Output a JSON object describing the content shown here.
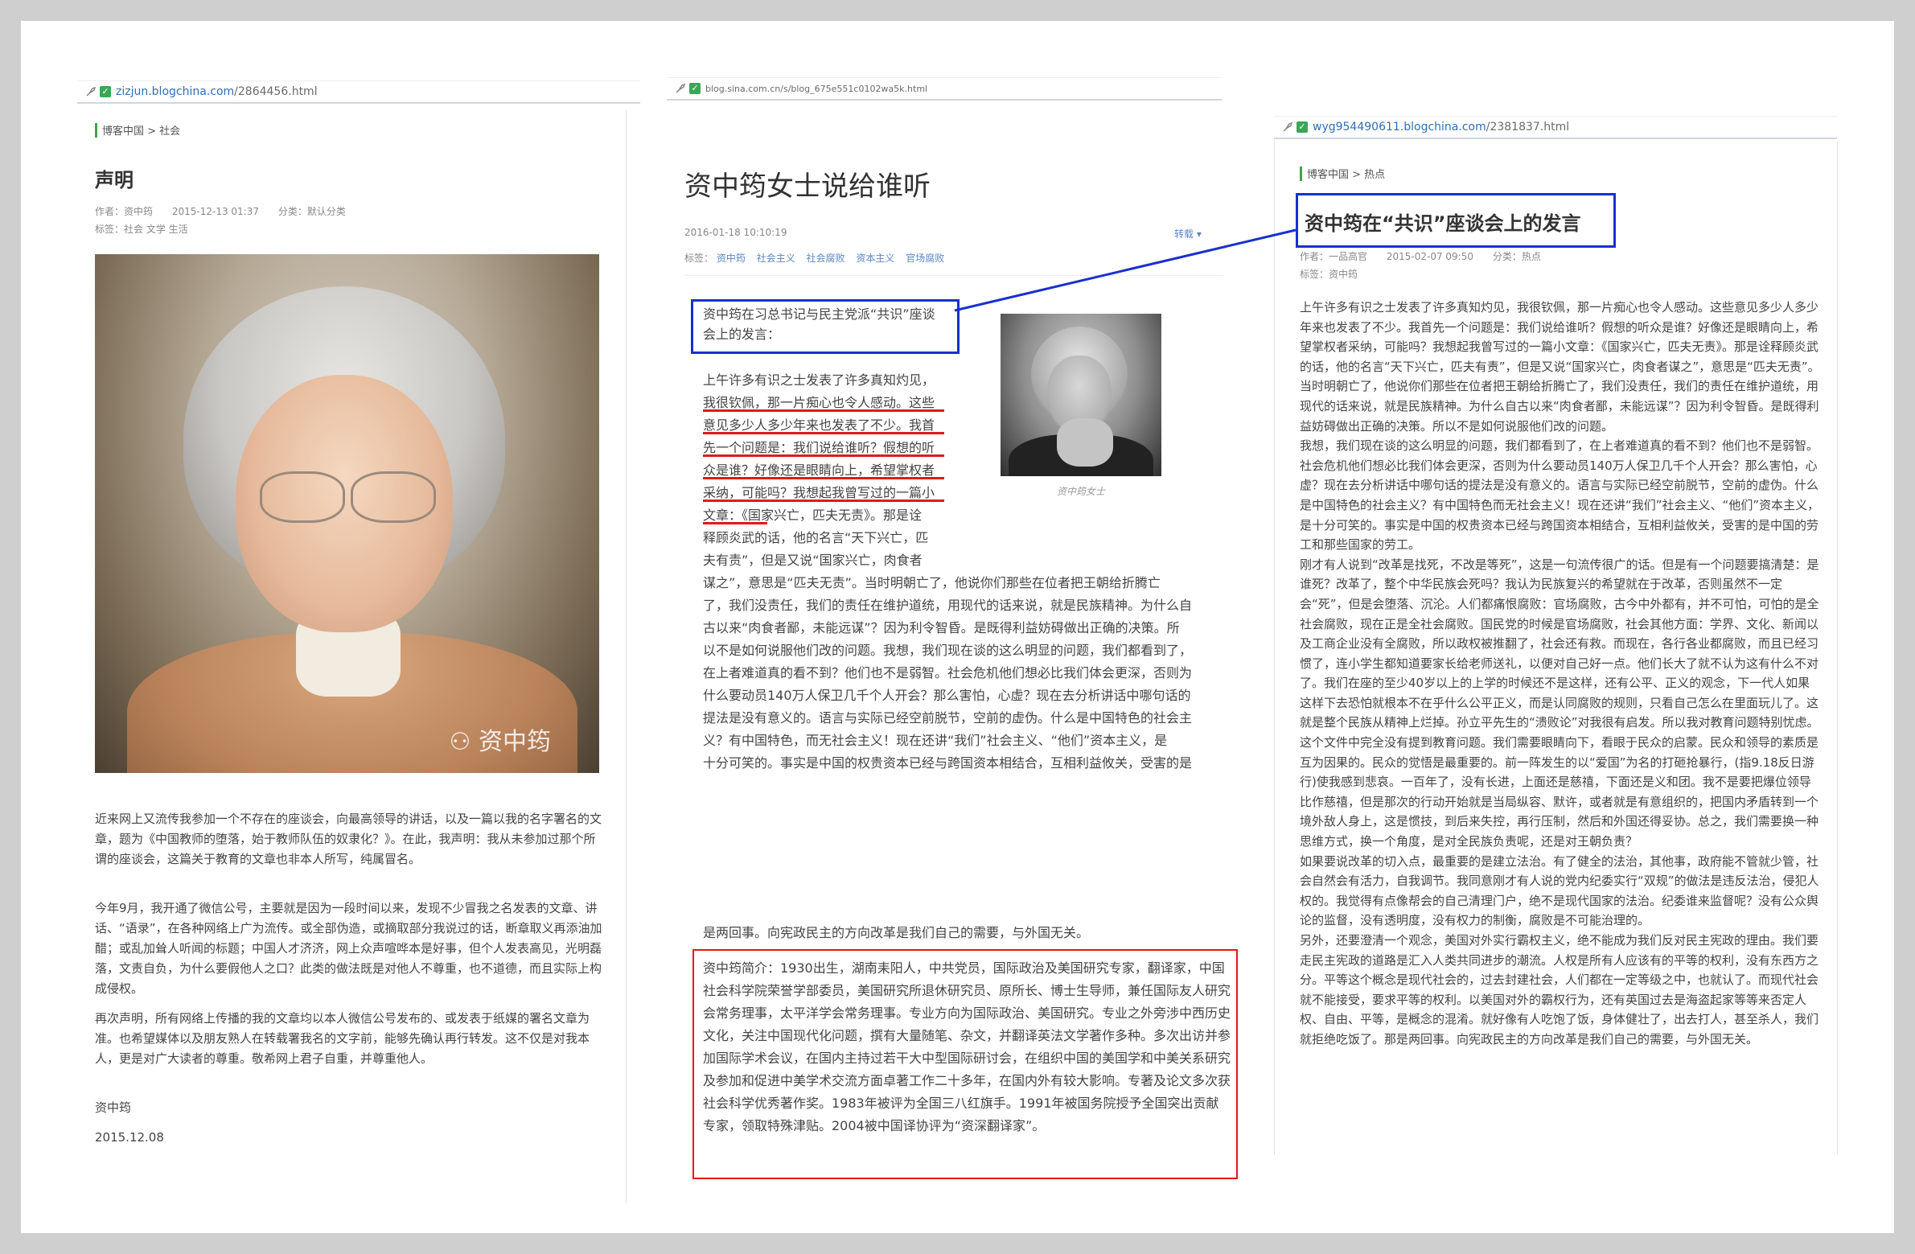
{
  "panel1": {
    "url_host": "zizjun.blogchina.com",
    "url_path": "/2864456.html",
    "breadcrumb": "博客中国 > 社会",
    "title": "声明",
    "meta_author": "作者：资中筠",
    "meta_date": "2015-12-13 01:37",
    "meta_category": "分类：默认分类",
    "tags": "标签：社会 文学 生活",
    "photo_watermark": "资中筠",
    "paragraphs": [
      "近来网上又流传我参加一个不存在的座谈会，向最高领导的讲话，以及一篇以我的名字署名的文章，题为《中国教师的堕落，始于教师队伍的奴隶化？》。在此，我声明：我从未参加过那个所谓的座谈会，这篇关于教育的文章也非本人所写，纯属冒名。",
      "今年9月，我开通了微信公号，主要就是因为一段时间以来，发现不少冒我之名发表的文章、讲话、“语录”，在各种网络上广为流传。或全部伪造，或摘取部分我说过的话，断章取义再添油加醋；或乱加耸人听闻的标题；中国人才济济，网上众声喧哗本是好事，但个人发表高见，光明磊落，文责自负，为什么要假他人之口？此类的做法既是对他人不尊重，也不道德，而且实际上构成侵权。",
      "再次声明，所有网络上传播的我的文章均以本人微信公号发布的、或发表于纸媒的署名文章为准。也希望媒体以及朋友熟人在转载署我名的文字前，能够先确认再行转发。这不仅是对我本人，更是对广大读者的尊重。敬希网上君子自重，并尊重他人。",
      "资中筠",
      "2015.12.08"
    ]
  },
  "panel2": {
    "url": "blog.sina.com.cn/s/blog_675e551c0102wa5k.html",
    "title": "资中筠女士说给谁听",
    "date": "2016-01-18 10:10:19",
    "reprint": "转载 ▾",
    "tags_label": "标签：",
    "tags": [
      "资中筠",
      "社会主义",
      "社会腐败",
      "资本主义",
      "官场腐败"
    ],
    "intro": "资中筠在习总书记与民主党派“共识”座谈会上的发言：",
    "photo_caption": "资中筠女士",
    "narrow_lines": [
      "上午许多有识之士发表了许多真知灼见，",
      "我很钦佩，那一片痴心也令人感动。这些",
      "意见多少人多少年来也发表了不少。我首",
      "先一个问题是：我们说给谁听？假想的听",
      "众是谁？好像还是眼睛向上，希望掌权者",
      "采纳，可能吗？我想起我曾写过的一篇小",
      "文章：《国家兴亡，匹夫无责》。那是诠",
      "释顾炎武的话，他的名言“天下兴亡，匹",
      "夫有责”，但是又说“国家兴亡，肉食者"
    ],
    "wide_lines": [
      "谋之”，意思是“匹夫无责”。当时明朝亡了，他说你们那些在位者把王朝给折腾亡",
      "了，我们没责任，我们的责任在维护道统，用现代的话来说，就是民族精神。为什么自",
      "古以来“肉食者鄙，未能远谋”？因为利令智昏。是既得利益妨碍做出正确的决策。所",
      "以不是如何说服他们改的问题。我想，我们现在谈的这么明显的问题，我们都看到了，",
      "在上者难道真的看不到？他们也不是弱智。社会危机他们想必比我们体会更深，否则为",
      "什么要动员140万人保卫几千个人开会？那么害怕，心虚？现在去分析讲话中哪句话的",
      "提法是没有意义的。语言与实际已经空前脱节，空前的虚伪。什么是中国特色的社会主",
      "义？有中国特色，而无社会主义！现在还讲“我们”社会主义、“他们”资本主义，是",
      "十分可笑的。事实是中国的权贵资本已经与跨国资本相结合，互相利益攸关，受害的是"
    ],
    "tail_lines": [
      "是两回事。向宪政民主的方向改革是我们自己的需要，与外国无关。"
    ],
    "bio": "资中筠简介：1930出生，湖南耒阳人，中共党员，国际政治及美国研究专家，翻译家，中国社会科学院荣誉学部委员，美国研究所退休研究员、原所长、博士生导师，兼任国际友人研究会常务理事，太平洋学会常务理事。专业方向为国际政治、美国研究。专业之外旁涉中西历史文化，关注中国现代化问题，撰有大量随笔、杂文，并翻译英法文学著作多种。多次出访并参加国际学术会议，在国内主持过若干大中型国际研讨会，在组织中国的美国学和中美关系研究及参加和促进中美学术交流方面卓著工作二十多年，在国内外有较大影响。专著及论文多次获社会科学优秀著作奖。1983年被评为全国三八红旗手。1991年被国务院授予全国突出贡献专家，领取特殊津贴。2004被中国译协评为“资深翻译家”。"
  },
  "panel3": {
    "url_host": "wyg954490611.blogchina.com",
    "url_path": "/2381837.html",
    "breadcrumb": "博客中国 > 热点",
    "title": "资中筠在“共识”座谈会上的发言",
    "meta_author": "作者：一品高官",
    "meta_date": "2015-02-07 09:50",
    "meta_category": "分类：热点",
    "tags": "标签：资中筠",
    "paragraphs": [
      "上午许多有识之士发表了许多真知灼见，我很钦佩，那一片痴心也令人感动。这些意见多少人多少年来也发表了不少。我首先一个问题是：我们说给谁听？假想的听众是谁？好像还是眼睛向上，希望掌权者采纳，可能吗？我想起我曾写过的一篇小文章：《国家兴亡，匹夫无责》。那是诠释顾炎武的话，他的名言“天下兴亡，匹夫有责”，但是又说“国家兴亡，肉食者谋之”，意思是“匹夫无责”。当时明朝亡了，他说你们那些在位者把王朝给折腾亡了，我们没责任，我们的责任在维护道统，用现代的话来说，就是民族精神。为什么自古以来“肉食者鄙，未能远谋”？因为利令智昏。是既得利益妨碍做出正确的决策。所以不是如何说服他们改的问题。",
      "我想，我们现在谈的这么明显的问题，我们都看到了，在上者难道真的看不到？他们也不是弱智。社会危机他们想必比我们体会更深，否则为什么要动员140万人保卫几千个人开会？那么害怕，心虚？现在去分析讲话中哪句话的提法是没有意义的。语言与实际已经空前脱节，空前的虚伪。什么是中国特色的社会主义？有中国特色而无社会主义！现在还讲“我们”社会主义、“他们”资本主义，是十分可笑的。事实是中国的权贵资本已经与跨国资本相结合，互相利益攸关，受害的是中国的劳工和那些国家的劳工。",
      "刚才有人说到“改革是找死，不改是等死”，这是一句流传很广的话。但是有一个问题要搞清楚：是谁死？改革了，整个中华民族会死吗？我认为民族复兴的希望就在于改革，否则虽然不一定会“死”，但是会堕落、沉沦。人们都痛恨腐败：官场腐败，古今中外都有，并不可怕，可怕的是全社会腐败，现在正是全社会腐败。国民党的时候是官场腐败，社会其他方面：学界、文化、新闻以及工商企业没有全腐败，所以政权被推翻了，社会还有救。而现在，各行各业都腐败，而且已经习惯了，连小学生都知道要家长给老师送礼，以便对自己好一点。他们长大了就不认为这有什么不对了。我们在座的至少40岁以上的上学的时候还不是这样，还有公平、正义的观念，下一代人如果这样下去恐怕就根本不在乎什么公平正义，而是认同腐败的规则，只看自己怎么在里面玩儿了。这就是整个民族从精神上烂掉。孙立平先生的“溃败论”对我很有启发。所以我对教育问题特别忧虑。这个文件中完全没有提到教育问题。我们需要眼睛向下，看眼于民众的启蒙。民众和领导的素质是互为因果的。民众的觉悟是最重要的。前一阵发生的以“爱国”为名的打砸抢暴行，(指9.18反日游行)使我感到悲哀。一百年了，没有长进，上面还是慈禧，下面还是义和团。我不是要把爆位领导比作慈禧，但是那次的行动开始就是当局纵容、默许，或者就是有意组织的，把国内矛盾转到一个境外敌人身上，这是惯技，到后来失控，再行压制，然后和外国还得妥协。总之，我们需要换一种思维方式，换一个角度，是对全民族负责呢，还是对王朝负责？",
      "如果要说改革的切入点，最重要的是建立法治。有了健全的法治，其他事，政府能不管就少管，社会自然会有活力，自我调节。我同意刚才有人说的党内纪委实行“双规”的做法是违反法治，侵犯人权的。我觉得有点像帮会的自己清理门户，绝不是现代国家的法治。纪委谁来监督呢？没有公众舆论的监督，没有透明度，没有权力的制衡，腐败是不可能治理的。",
      "另外，还要澄清一个观念，美国对外实行霸权主义，绝不能成为我们反对民主宪政的理由。我们要走民主宪政的道路是汇入人类共同进步的潮流。人权是所有人应该有的平等的权利，没有东西方之分。平等这个概念是现代社会的，过去封建社会，人们都在一定等级之中，也就认了。而现代社会就不能接受，要求平等的权利。以美国对外的霸权行为，还有英国过去是海盗起家等等来否定人权、自由、平等，是概念的混淆。就好像有人吃饱了饭，身体健壮了，出去打人，甚至杀人，我们就拒绝吃饭了。那是两回事。向宪政民主的方向改革是我们自己的需要，与外国无关。"
    ]
  },
  "colors": {
    "annotation_blue": "#1a2fd0",
    "annotation_red": "#e01919",
    "link": "#2f6fb5",
    "crumb_bar": "#3fa34d"
  }
}
